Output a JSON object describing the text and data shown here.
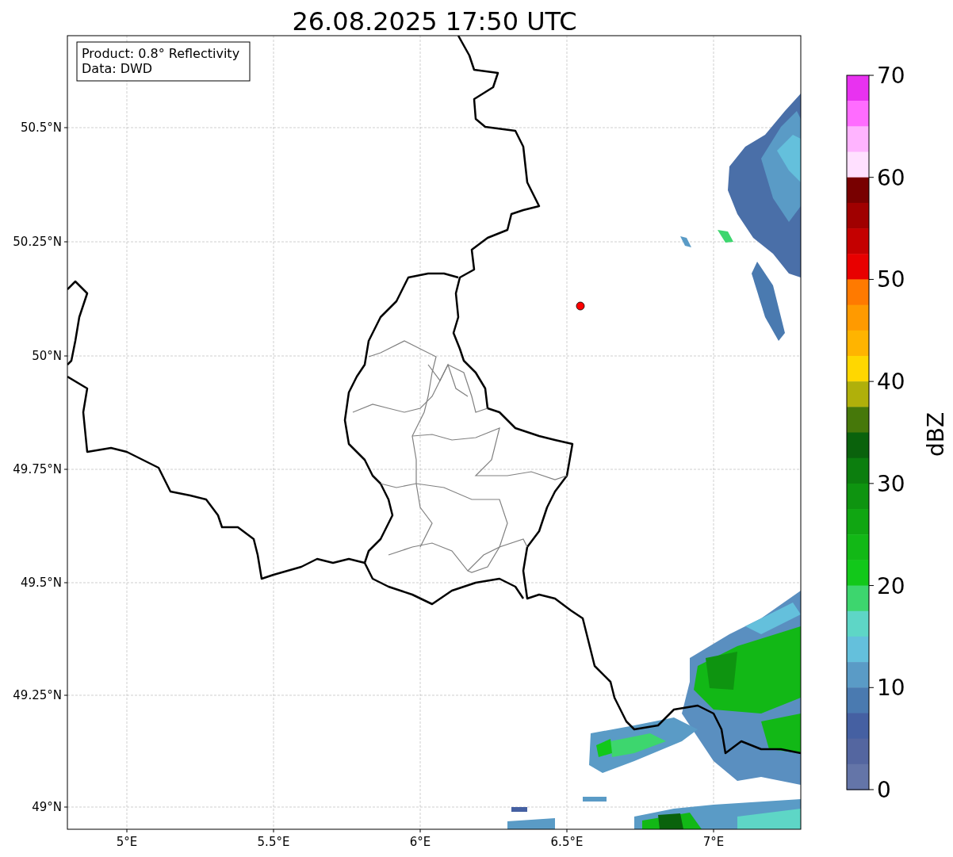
{
  "title": "26.08.2025 17:50 UTC",
  "map": {
    "info_box": [
      "Product: 0.8° Reflectivity",
      "Data: DWD"
    ],
    "yticks": [
      "50.5°N",
      "50.25°N",
      "50°N",
      "49.75°N",
      "49.5°N",
      "49.25°N",
      "49°N"
    ],
    "xticks": [
      "5°E",
      "5.5°E",
      "6°E",
      "6.5°E",
      "7°E"
    ]
  },
  "colorbar": {
    "label": "dBZ",
    "ticks": [
      "70",
      "60",
      "50",
      "40",
      "30",
      "20",
      "10",
      "0"
    ],
    "bands": [
      {
        "color": "#e832f0"
      },
      {
        "color": "#ff6cff"
      },
      {
        "color": "#ffb4ff"
      },
      {
        "color": "#ffe0ff"
      },
      {
        "color": "#780000"
      },
      {
        "color": "#a00000"
      },
      {
        "color": "#c40000"
      },
      {
        "color": "#e80000"
      },
      {
        "color": "#ff7a00"
      },
      {
        "color": "#ff9a00"
      },
      {
        "color": "#ffb400"
      },
      {
        "color": "#ffd700"
      },
      {
        "color": "#b0b00a"
      },
      {
        "color": "#46780a"
      },
      {
        "color": "#0a620c"
      },
      {
        "color": "#0c7e0e"
      },
      {
        "color": "#0e9410"
      },
      {
        "color": "#10a612"
      },
      {
        "color": "#12b816"
      },
      {
        "color": "#12c81a"
      },
      {
        "color": "#3dd66e"
      },
      {
        "color": "#5ed6c6"
      },
      {
        "color": "#64c0dc"
      },
      {
        "color": "#5a9bc6"
      },
      {
        "color": "#4a7ab0"
      },
      {
        "color": "#4560a2"
      },
      {
        "color": "#5466a0"
      },
      {
        "color": "#6475a8"
      }
    ]
  }
}
